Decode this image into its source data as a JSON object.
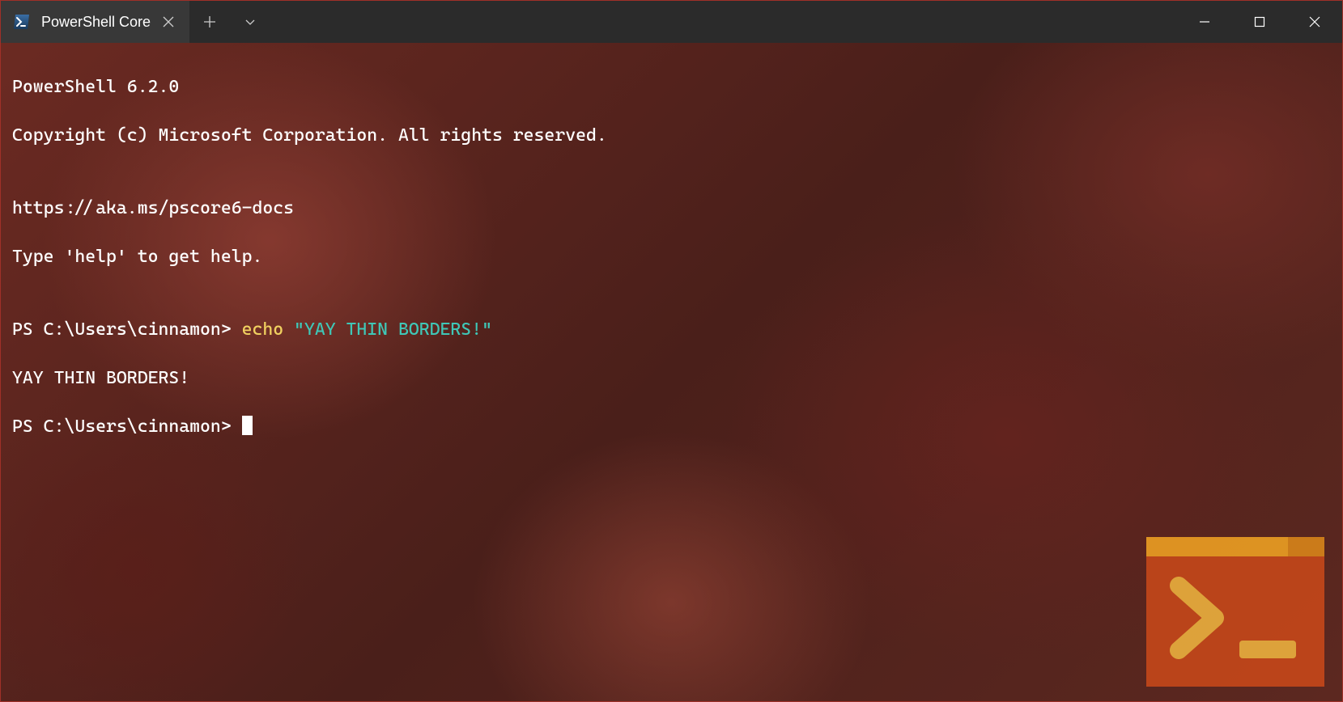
{
  "tab": {
    "label": "PowerShell Core"
  },
  "terminal": {
    "line1": "PowerShell 6.2.0",
    "line2": "Copyright (c) Microsoft Corporation. All rights reserved.",
    "line3": "",
    "line4": "https://aka.ms/pscore6-docs",
    "line5": "Type 'help' to get help.",
    "line6": "",
    "prompt1": "PS C:\\Users\\cinnamon> ",
    "cmd_echo": "echo ",
    "cmd_string": "\"YAY THIN BORDERS!\"",
    "output1": "YAY THIN BORDERS!",
    "prompt2": "PS C:\\Users\\cinnamon> "
  }
}
